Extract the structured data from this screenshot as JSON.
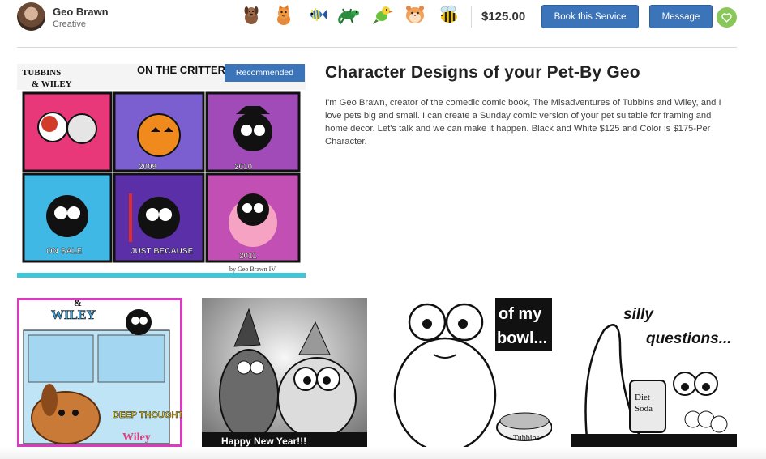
{
  "provider": {
    "name": "Geo Brawn",
    "role": "Creative"
  },
  "pets": [
    {
      "icon": "dog-icon"
    },
    {
      "icon": "cat-icon"
    },
    {
      "icon": "fish-icon"
    },
    {
      "icon": "lizard-icon"
    },
    {
      "icon": "bird-icon"
    },
    {
      "icon": "hamster-icon"
    },
    {
      "icon": "bee-icon"
    }
  ],
  "price": "$125.00",
  "buttons": {
    "book": "Book this Service",
    "message": "Message"
  },
  "listing": {
    "badge": "Recommended",
    "title": "Character Designs of your Pet-By Geo",
    "description": "I'm Geo Brawn, creator of the comedic comic book, The Misadventures of Tubbins and Wiley, and I love pets big and small. I can create a Sunday comic version of your pet suitable for framing and home decor. Let's talk and we can make it happen. Black and White $125 and Color is $175-Per Character."
  },
  "colors": {
    "accent": "#3b74b8",
    "heart": "#8ac75a"
  },
  "gallery_captions": [
    "ON THE CRITTERS",
    "2009",
    "2010",
    "ON SALE",
    "JUST BECAUSE",
    "2011",
    "Happy New Year!!!",
    "of my bowl...",
    "silly questions...",
    "DEEP THOUGHTS:",
    "Tubbins",
    "& WILEY"
  ]
}
